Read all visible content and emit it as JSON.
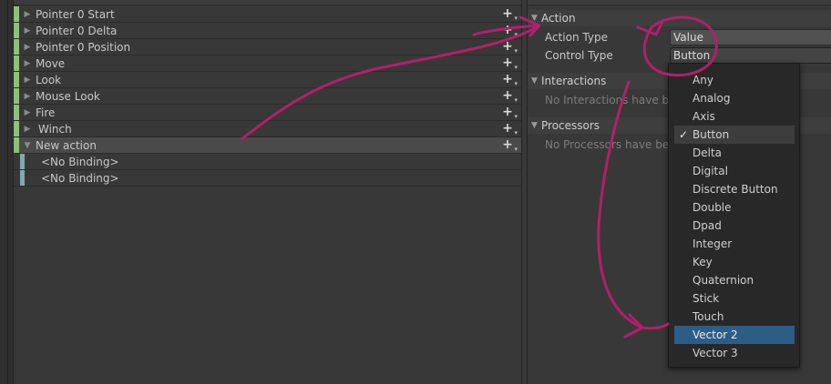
{
  "actions": [
    {
      "label": "Pointer 0 Start",
      "expanded": false
    },
    {
      "label": "Pointer 0 Delta",
      "expanded": false
    },
    {
      "label": "Pointer 0 Position",
      "expanded": false
    },
    {
      "label": "Move",
      "expanded": false
    },
    {
      "label": "Look",
      "expanded": false
    },
    {
      "label": "Mouse Look",
      "expanded": false
    },
    {
      "label": "Fire",
      "expanded": false
    },
    {
      "label": "Winch",
      "expanded": false
    },
    {
      "label": "New action",
      "expanded": true
    }
  ],
  "bindings": [
    {
      "label": "<No Binding>"
    },
    {
      "label": "<No Binding>"
    }
  ],
  "properties": {
    "action_section": "Action",
    "action_type_label": "Action Type",
    "action_type_value": "Value",
    "control_type_label": "Control Type",
    "control_type_value": "Button",
    "interactions_section": "Interactions",
    "interactions_empty": "No Interactions have bee",
    "processors_section": "Processors",
    "processors_empty": "No Processors have bee"
  },
  "control_type_options": [
    "Any",
    "Analog",
    "Axis",
    "Button",
    "Delta",
    "Digital",
    "Discrete Button",
    "Double",
    "Dpad",
    "Integer",
    "Key",
    "Quaternion",
    "Stick",
    "Touch",
    "Vector 2",
    "Vector 3"
  ],
  "selected_option": "Button",
  "highlighted_option": "Vector 2",
  "icons": {
    "collapsed_arrow": "triangle-right-icon",
    "expanded_arrow": "triangle-down-icon",
    "add": "plus-dropdown-icon",
    "checkmark": "checkmark-icon"
  },
  "colors": {
    "action_bar": "#8fbf7a",
    "binding_bar": "#86a8b3",
    "highlight": "#2c5d87",
    "annotation": "#b0206a"
  }
}
